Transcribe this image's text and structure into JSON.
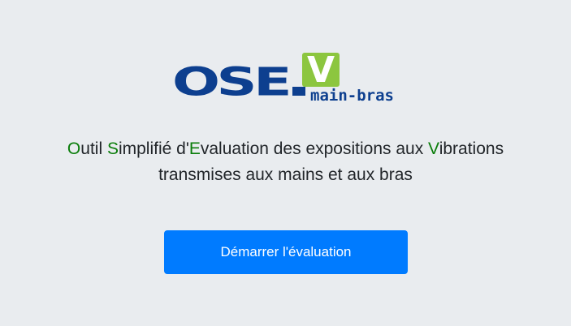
{
  "logo": {
    "main_text": "OSE",
    "badge_letter": "V",
    "subtitle": "main-bras",
    "colors": {
      "blue": "#0d3f8f",
      "green": "#8cc63f"
    }
  },
  "tagline": {
    "line1": [
      {
        "text": "O",
        "highlight": true
      },
      {
        "text": "util ",
        "highlight": false
      },
      {
        "text": "S",
        "highlight": true
      },
      {
        "text": "implifié d'",
        "highlight": false
      },
      {
        "text": "E",
        "highlight": true
      },
      {
        "text": "valuation des expositions aux ",
        "highlight": false
      },
      {
        "text": "V",
        "highlight": true
      },
      {
        "text": "ibrations",
        "highlight": false
      }
    ],
    "line2": "transmises aux mains et aux bras",
    "highlight_color": "#0a7d0a"
  },
  "actions": {
    "start_label": "Démarrer l'évaluation",
    "start_color": "#007bff"
  }
}
